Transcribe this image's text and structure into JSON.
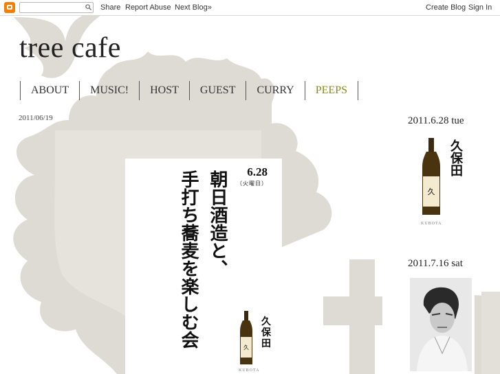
{
  "navbar": {
    "share": "Share",
    "report_abuse": "Report Abuse",
    "next_blog": "Next Blog»",
    "create_blog": "Create Blog",
    "sign_in": "Sign In"
  },
  "header": {
    "title": "tree cafe",
    "tabs": [
      {
        "label": "ABOUT"
      },
      {
        "label": "MUSIC!"
      },
      {
        "label": "HOST"
      },
      {
        "label": "GUEST"
      },
      {
        "label": "CURRY"
      },
      {
        "label": "PEEPS"
      }
    ],
    "active_tab_color": "#8a8a1a"
  },
  "post": {
    "date": "2011/06/19",
    "flyer": {
      "date": "6.28",
      "day": "（火曜日）",
      "line1": "朝日酒造と、",
      "line2": "手打ち蕎麦を楽しむ会",
      "brand_label": "KUBOTA"
    }
  },
  "sidebar": {
    "event1": {
      "heading": "2011.6.28 tue",
      "brand_label": "KUBOTA"
    },
    "event2": {
      "heading": "2011.7.16 sat"
    }
  },
  "colors": {
    "decoration": "#dedbd4",
    "text": "#222222"
  }
}
